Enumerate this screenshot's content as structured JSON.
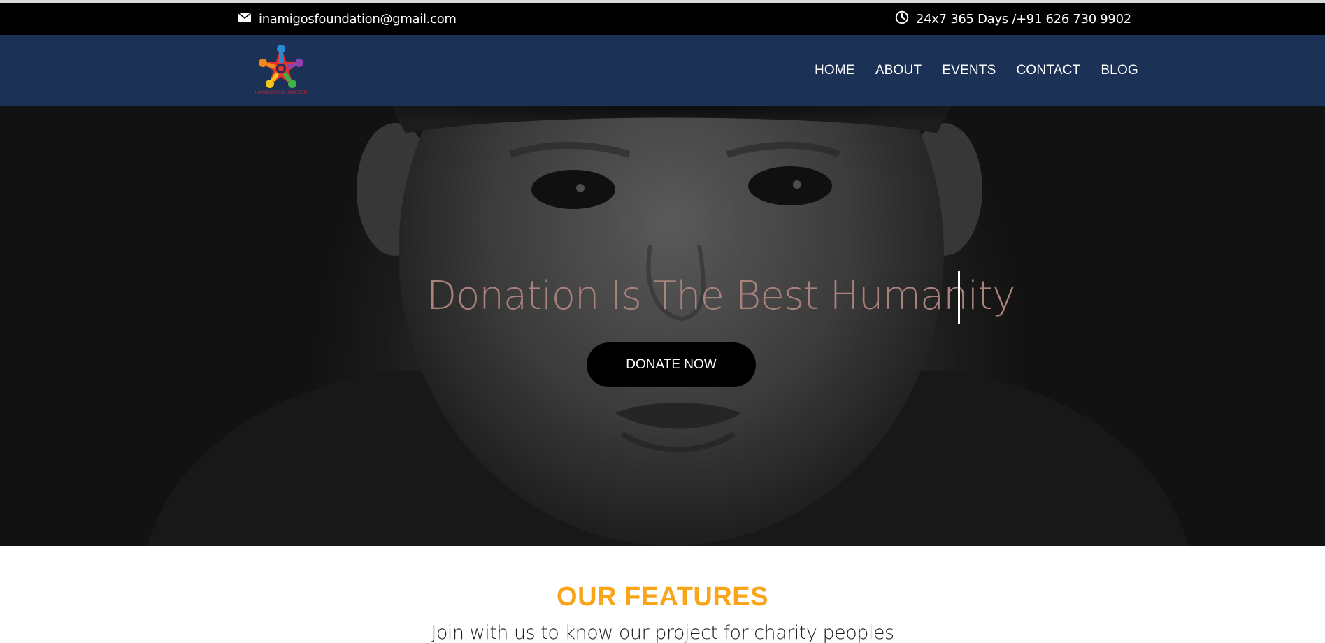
{
  "topbar": {
    "email": "inamigosfoundation@gmail.com",
    "hours": "24x7 365 Days /+91 626 730 9902",
    "email_icon": "envelope-icon",
    "hours_icon": "clock-icon"
  },
  "nav": {
    "logo_text": "INAMIGOS FOUNDATION",
    "items": [
      {
        "label": "HOME"
      },
      {
        "label": "ABOUT"
      },
      {
        "label": "EVENTS"
      },
      {
        "label": "CONTACT"
      },
      {
        "label": "BLOG"
      }
    ]
  },
  "hero": {
    "title": "Donation Is The Best Humanity",
    "button_label": "DONATE NOW"
  },
  "features": {
    "title": "OUR FEATURES",
    "subtitle": "Join with us to know our project for charity peoples"
  },
  "colors": {
    "topbar_bg": "#000000",
    "nav_bg": "#1b3156",
    "accent": "#f9a51a",
    "hero_title": "#a9827b"
  }
}
